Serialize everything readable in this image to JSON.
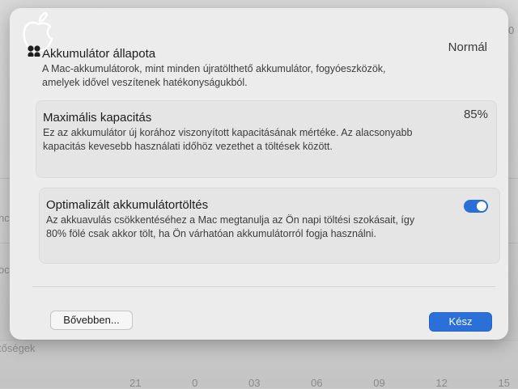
{
  "background": {
    "left_labels": [
      "nce",
      "ock",
      "tőségek"
    ],
    "corner_digit": "0",
    "axis_labels": [
      "21",
      "0",
      "03",
      "06",
      "09",
      "12",
      "15"
    ]
  },
  "dialog": {
    "battery_health": {
      "title": "Akkumulátor állapota",
      "value": "Normál",
      "description": "A Mac-akkumulátorok, mint minden újratölthető akkumulátor, fogyóeszközök, amelyek idővel veszítenek hatékonyságukból."
    },
    "max_capacity": {
      "title": "Maximális kapacitás",
      "value": "85%",
      "description": "Ez az akkumulátor új korához viszonyított kapacitásának mértéke. Az alacsonyabb kapacitás kevesebb használati időhöz vezethet a töltések között."
    },
    "optimized_charging": {
      "title": "Optimalizált akkumulátortöltés",
      "enabled": true,
      "description": "Az akkuavulás csökkentéséhez a Mac megtanulja az Ön napi töltési szokásait, így 80% fölé csak akkor tölt, ha Ön várhatóan akkumulátorról fogja használni."
    },
    "buttons": {
      "more_info": "Bővebben...",
      "done": "Kész"
    }
  },
  "colors": {
    "accent": "#2b6fd8",
    "sheet_bg": "#ececec",
    "section_bg": "#e5e5e5"
  },
  "icons": [
    "apple-logo-icon"
  ]
}
